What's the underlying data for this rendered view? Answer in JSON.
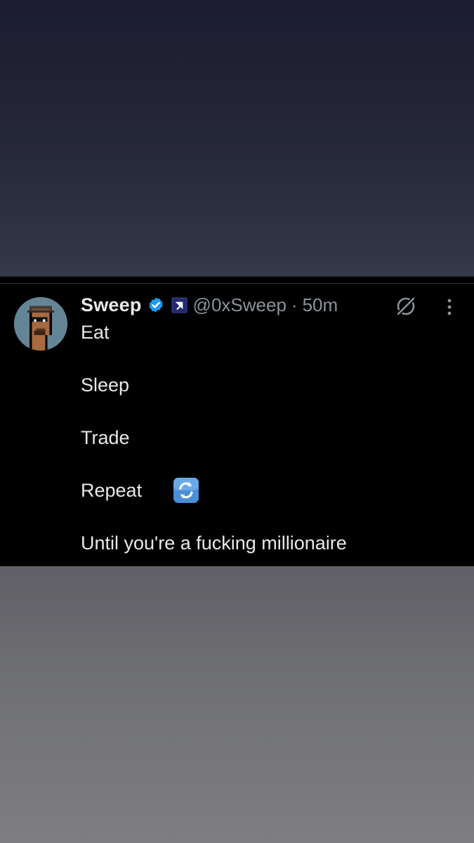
{
  "tweet": {
    "display_name": "Sweep",
    "handle": "@0xSweep",
    "separator": "·",
    "time": "50m",
    "verified_icon": "blue-verified-badge-icon",
    "affiliation_icon": "affiliation-badge-icon",
    "avatar": "pixel-punk-avatar",
    "lines": {
      "l1": "Eat",
      "l2": "Sleep",
      "l3": "Trade",
      "l4": "Repeat",
      "l5": "Until you're a fucking millionaire"
    },
    "repeat_emoji": "repeat-arrows-emoji",
    "actions": {
      "grok_icon": "grok-icon",
      "more_icon": "more-vertical-icon"
    }
  },
  "colors": {
    "card_bg": "#000000",
    "primary_text": "#e7e9ea",
    "secondary_text": "#8b9299",
    "verified_blue": "#1d9bf0",
    "avatar_bg": "#638596"
  }
}
